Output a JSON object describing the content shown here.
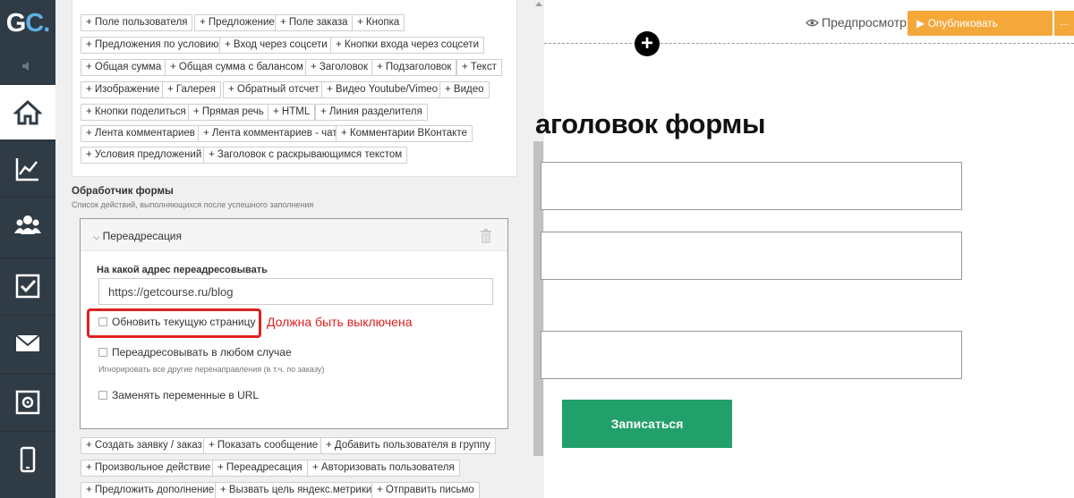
{
  "nav": {
    "logo": {
      "g": "G",
      "c": "C."
    },
    "items": [
      {
        "name": "home-icon",
        "active": true
      },
      {
        "name": "chart-icon",
        "active": false
      },
      {
        "name": "users-icon",
        "active": false
      },
      {
        "name": "checkbox-icon",
        "active": false
      },
      {
        "name": "mail-icon",
        "active": false
      },
      {
        "name": "safe-icon",
        "active": false
      },
      {
        "name": "phone-icon",
        "active": false
      }
    ]
  },
  "blocks": [
    "+ Поле пользователя",
    "+ Предложение",
    "+ Поле заказа",
    "+ Кнопка",
    "+ Предложения по условию",
    "+ Вход через соцсети",
    "+ Кнопки входа через соцсети",
    "+ Общая сумма",
    "+ Общая сумма с балансом",
    "+ Заголовок",
    "+ Подзаголовок",
    "+ Текст",
    "+ Изображение",
    "+ Галерея",
    "+ Обратный отсчет",
    "+ Видео Youtube/Vimeo",
    "+ Видео",
    "+ Кнопки поделиться",
    "+ Прямая речь",
    "+ HTML",
    "+ Линия разделителя",
    "+ Лента комментариев",
    "+ Лента комментариев - чат",
    "+ Комментарии ВКонтакте",
    "+ Условия предложений",
    "+ Заголовок с раскрывающимся текстом"
  ],
  "handler": {
    "title": "Обработчик формы",
    "subtitle": "Список действий, выполняющихся после успешного заполнения",
    "item_title": "Переадресация",
    "url_label": "На какой адрес переадресовывать",
    "url_value": "https://getcourse.ru/blog",
    "checkboxes": [
      {
        "label": "Обновить текущую страницу",
        "checked": false
      },
      {
        "label": "Переадресовывать в любом случае",
        "checked": false
      },
      {
        "label": "Заменять переменные в URL",
        "checked": false
      }
    ],
    "hint": "Игнорировать все другие перенаправления (в т.ч. по заказу)",
    "annotation": "Должна быть выключена"
  },
  "actions": [
    "+ Создать заявку / заказ",
    "+ Показать сообщение",
    "+ Добавить пользователя в группу",
    "+ Произвольное действие",
    "+ Переадресация",
    "+ Авторизовать пользователя",
    "+ Предложить дополнение",
    "+ Вызвать цель яндекс.метрики",
    "+ Отправить письмо"
  ],
  "preview": {
    "preview_label": "Предпросмотр",
    "publish_label": "▶ Опубликовать изменения",
    "more_label": "...",
    "heading": "аголовок формы",
    "submit_label": "Записаться"
  },
  "colors": {
    "accent": "#f5a83a",
    "submit": "#22a06b",
    "annotation": "#e02020",
    "nav": "#2f3b45"
  }
}
